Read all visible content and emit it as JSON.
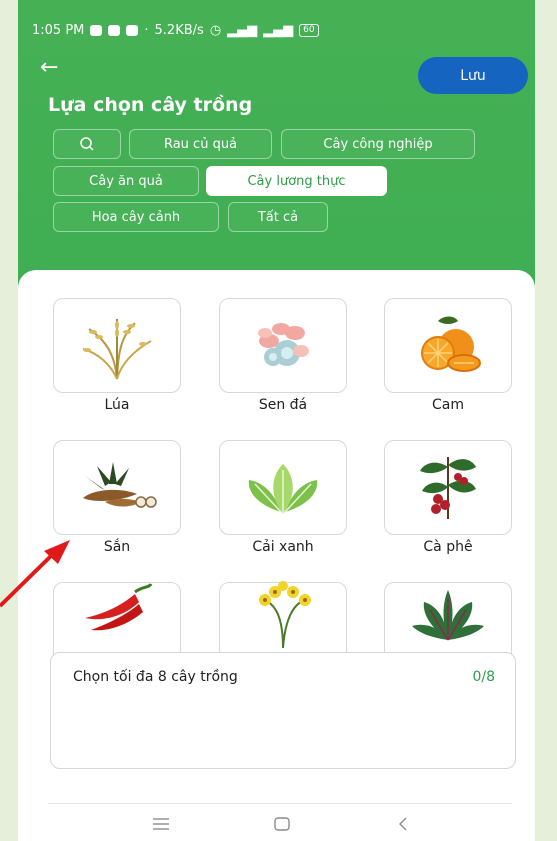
{
  "status_bar": {
    "time": "1:05 PM",
    "net_speed": "5.2KB/s",
    "battery": "60"
  },
  "header": {
    "title": "Lựa chọn cây trồng",
    "save_label": "Lưu"
  },
  "filters": {
    "search_icon": "search-icon",
    "chips": [
      "Rau củ quả",
      "Cây công nghiệp",
      "Cây ăn quả",
      "Cây lương thực",
      "Hoa cây cảnh",
      "Tất cả"
    ],
    "active": "Cây lương thực"
  },
  "crops": [
    {
      "name": "Lúa",
      "icon": "rice-icon"
    },
    {
      "name": "Sen đá",
      "icon": "succulent-icon"
    },
    {
      "name": "Cam",
      "icon": "orange-icon"
    },
    {
      "name": "Sắn",
      "icon": "cassava-icon"
    },
    {
      "name": "Cải xanh",
      "icon": "mustard-greens-icon"
    },
    {
      "name": "Cà phê",
      "icon": "coffee-icon"
    },
    {
      "name": "",
      "icon": "chili-icon"
    },
    {
      "name": "",
      "icon": "orchid-icon"
    },
    {
      "name": "",
      "icon": "leafy-vegetable-icon"
    }
  ],
  "selection": {
    "label": "Chọn tối đa 8 cây trồng",
    "count": "0/8"
  },
  "colors": {
    "header": "#3fae52",
    "save_button": "#1565c0",
    "count": "#2e9e4a",
    "arrow": "#e11919"
  }
}
